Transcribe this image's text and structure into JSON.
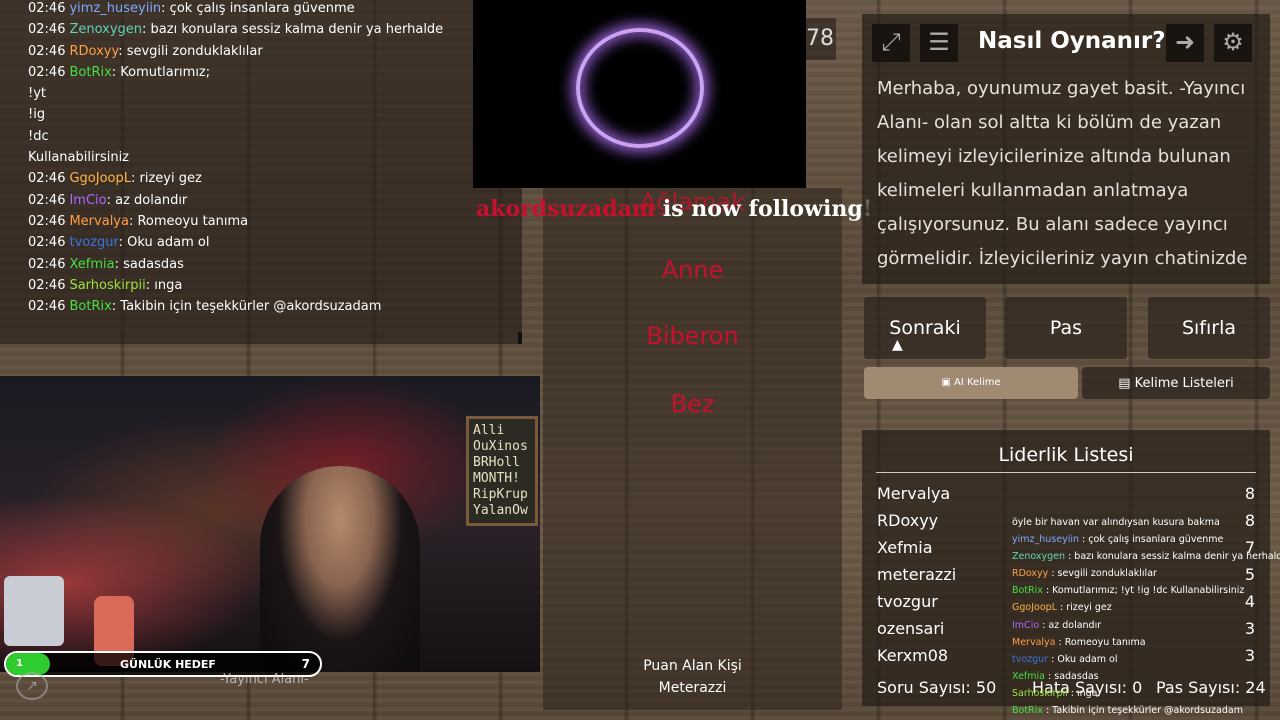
{
  "chat": {
    "lines": [
      {
        "time": "02:46",
        "user": "yimz_huseyiin",
        "color": "#7ea7ff",
        "msg": ": çok çalış insanlara güvenme"
      },
      {
        "time": "02:46",
        "user": "Zenoxygen",
        "color": "#5fd3b3",
        "msg": ": bazı konulara sessiz kalma denir ya herhalde"
      },
      {
        "time": "02:46",
        "user": "RDoxyy",
        "color": "#ff9f45",
        "msg": ": sevgili zonduklaklılar"
      },
      {
        "time": "02:46",
        "user": "BotRix",
        "color": "#44e044",
        "msg": ": Komutlarımız;"
      },
      {
        "time": "",
        "user": "",
        "color": "#fff",
        "msg": "!yt"
      },
      {
        "time": "",
        "user": "",
        "color": "#fff",
        "msg": "!ig"
      },
      {
        "time": "",
        "user": "",
        "color": "#fff",
        "msg": "!dc"
      },
      {
        "time": "",
        "user": "",
        "color": "#fff",
        "msg": "Kullanabilirsiniz"
      },
      {
        "time": "02:46",
        "user": "GgoJoopL",
        "color": "#ffb347",
        "msg": ": rizeyi gez"
      },
      {
        "time": "02:46",
        "user": "ImCio",
        "color": "#b066ff",
        "msg": ": az dolandır"
      },
      {
        "time": "02:46",
        "user": "Mervalya",
        "color": "#ff9f45",
        "msg": ": Romeoyu tanıma"
      },
      {
        "time": "02:46",
        "user": "tvozgur",
        "color": "#3b73e0",
        "msg": ": Oku adam ol"
      },
      {
        "time": "02:46",
        "user": "Xefmia",
        "color": "#44e044",
        "msg": ": sadasdas"
      },
      {
        "time": "02:46",
        "user": "Sarhoskirpii",
        "color": "#9fe040",
        "msg": ": ınga"
      },
      {
        "time": "02:46",
        "user": "BotRix",
        "color": "#44e044",
        "msg": ": Takibin için teşekkürler @akordsuzadam"
      }
    ]
  },
  "follow": {
    "name": "akordsuzadam",
    "text": " is now following!"
  },
  "words": [
    "Ağlamak",
    "Anne",
    "Biberon",
    "Bez"
  ],
  "counter": "78",
  "scorer": {
    "title": "Puan Alan Kişi",
    "name": "Meterazzi"
  },
  "webcam": {
    "board_text": "Alli\nOuXinos\nBRHoll\nMONTH!\nRipKrup\nYalanOw"
  },
  "goal": {
    "current": "1",
    "label": "GÜNLÜK HEDEF",
    "target": "7",
    "progress": 0.14
  },
  "streamer_area": "-Yayıncı Alanı-",
  "panel": {
    "title": "Nasıl Oynanır?",
    "text": "Merhaba, oyunumuz gayet basit. -Yayıncı Alanı- olan sol altta ki bölüm de yazan kelimeyi izleyicilerinize altında bulunan kelimeleri kullanmadan anlatmaya çalışıyorsunuz. Bu alanı sadece yayıncı görmelidir. İzleyicileriniz yayın chatinizde",
    "icons": {
      "expand": "expand-icon",
      "notes": "notes-icon",
      "exit": "exit-icon",
      "settings": "gear-icon"
    }
  },
  "buttons": {
    "next": "Sonraki",
    "pass": "Pas",
    "reset": "Sıfırla",
    "ai": "AI Kelime",
    "lists": "Kelime Listeleri"
  },
  "leaderboard": {
    "title": "Liderlik Listesi",
    "rows": [
      {
        "name": "Mervalya",
        "score": "8"
      },
      {
        "name": "RDoxyy",
        "score": "8"
      },
      {
        "name": "Xefmia",
        "score": "7"
      },
      {
        "name": "meterazzi",
        "score": "5"
      },
      {
        "name": "tvozgur",
        "score": "4"
      },
      {
        "name": "ozensari",
        "score": "3"
      },
      {
        "name": "Kerxm08",
        "score": "3"
      }
    ]
  },
  "stats": {
    "questions": "Soru Sayısı: 50",
    "errors": "Hata Sayısı: 0",
    "passes": "Pas Sayısı: 24"
  },
  "mini_chat": [
    {
      "user": "",
      "color": "#fff",
      "msg": "öyle bir havan var alındıysan kusura bakma"
    },
    {
      "user": "yimz_huseyiin",
      "color": "#7ea7ff",
      "msg": " : çok çalış insanlara güvenme"
    },
    {
      "user": "Zenoxygen",
      "color": "#5fd3b3",
      "msg": " : bazı konulara sessiz kalma denir ya herhalde"
    },
    {
      "user": "RDoxyy",
      "color": "#ff9f45",
      "msg": " : sevgili zonduklaklılar"
    },
    {
      "user": "BotRix",
      "color": "#44e044",
      "msg": " : Komutlarımız; !yt !ig !dc Kullanabilirsiniz"
    },
    {
      "user": "GgoJoopL",
      "color": "#ffb347",
      "msg": " : rizeyi gez"
    },
    {
      "user": "ImCio",
      "color": "#b066ff",
      "msg": " : az dolandır"
    },
    {
      "user": "Mervalya",
      "color": "#ff9f45",
      "msg": " : Romeoyu tanıma"
    },
    {
      "user": "tvozgur",
      "color": "#3b73e0",
      "msg": " : Oku adam ol"
    },
    {
      "user": "Xefmia",
      "color": "#44e044",
      "msg": " : sadasdas"
    },
    {
      "user": "Sarhoskirpii",
      "color": "#9fe040",
      "msg": " : ınga"
    },
    {
      "user": "BotRix",
      "color": "#44e044",
      "msg": " : Takibin için teşekkürler @akordsuzadam"
    }
  ]
}
